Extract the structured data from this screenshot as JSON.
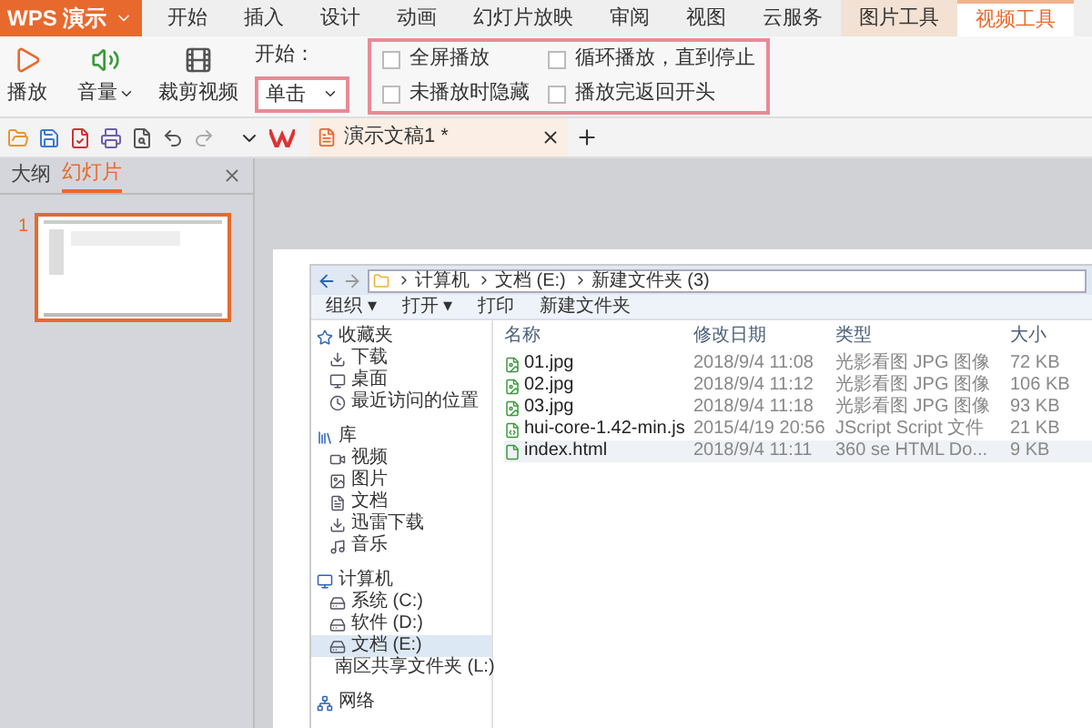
{
  "app_menu": {
    "title": "WPS 演示"
  },
  "ribbon_tabs": [
    {
      "label": "开始",
      "selected": false
    },
    {
      "label": "插入",
      "selected": false
    },
    {
      "label": "设计",
      "selected": false
    },
    {
      "label": "动画",
      "selected": false
    },
    {
      "label": "幻灯片放映",
      "selected": false
    },
    {
      "label": "审阅",
      "selected": false
    },
    {
      "label": "视图",
      "selected": false
    },
    {
      "label": "云服务",
      "selected": false
    },
    {
      "label": "图片工具",
      "selected": false
    },
    {
      "label": "视频工具",
      "selected": true
    }
  ],
  "ribbon": {
    "play": "播放",
    "volume": "音量",
    "crop": "裁剪视频",
    "start_label": "开始：",
    "start_value": "单击",
    "options": [
      {
        "label": "全屏播放",
        "checked": false
      },
      {
        "label": "未播放时隐藏",
        "checked": false
      },
      {
        "label": "循环播放，直到停止",
        "checked": false
      },
      {
        "label": "播放完返回开头",
        "checked": false
      }
    ]
  },
  "doc_tabs": [
    {
      "title": "演示文稿1 *",
      "selected": true
    }
  ],
  "panel": {
    "tabs": [
      {
        "label": "大纲",
        "selected": false
      },
      {
        "label": "幻灯片",
        "selected": true
      }
    ],
    "slides": [
      {
        "number": "1",
        "selected": true
      }
    ]
  },
  "explorer": {
    "breadcrumb": [
      "计算机",
      "文档 (E:)",
      "新建文件夹 (3)"
    ],
    "toolbar": [
      "组织 ▾",
      "打开 ▾",
      "打印",
      "新建文件夹"
    ],
    "nav": [
      {
        "label": "收藏夹",
        "selected": false,
        "children": [
          {
            "label": "下载",
            "selected": false
          },
          {
            "label": "桌面",
            "selected": false
          },
          {
            "label": "最近访问的位置",
            "selected": false
          }
        ]
      },
      {
        "label": "库",
        "selected": false,
        "children": [
          {
            "label": "视频",
            "selected": false
          },
          {
            "label": "图片",
            "selected": false
          },
          {
            "label": "文档",
            "selected": false
          },
          {
            "label": "迅雷下载",
            "selected": false
          },
          {
            "label": "音乐",
            "selected": false
          }
        ]
      },
      {
        "label": "计算机",
        "selected": false,
        "children": [
          {
            "label": "系统 (C:)",
            "selected": false
          },
          {
            "label": "软件 (D:)",
            "selected": false
          },
          {
            "label": "文档 (E:)",
            "selected": true
          },
          {
            "label": "南区共享文件夹 (L:)",
            "selected": false
          }
        ]
      },
      {
        "label": "网络",
        "selected": false
      }
    ],
    "columns": [
      "名称",
      "修改日期",
      "类型",
      "大小"
    ],
    "rows": [
      {
        "kind": "image",
        "selected": false,
        "cells": [
          "01.jpg",
          "2018/9/4 11:08",
          "光影看图 JPG 图像",
          "72 KB"
        ]
      },
      {
        "kind": "image",
        "selected": false,
        "cells": [
          "02.jpg",
          "2018/9/4 11:12",
          "光影看图 JPG 图像",
          "106 KB"
        ]
      },
      {
        "kind": "image",
        "selected": false,
        "cells": [
          "03.jpg",
          "2018/9/4 11:18",
          "光影看图 JPG 图像",
          "93 KB"
        ]
      },
      {
        "kind": "script",
        "selected": false,
        "cells": [
          "hui-core-1.42-min.js",
          "2015/4/19 20:56",
          "JScript Script 文件",
          "21 KB"
        ]
      },
      {
        "kind": "html",
        "selected": true,
        "cells": [
          "index.html",
          "2018/9/4 11:11",
          "360 se HTML Do...",
          "9 KB"
        ]
      }
    ]
  }
}
